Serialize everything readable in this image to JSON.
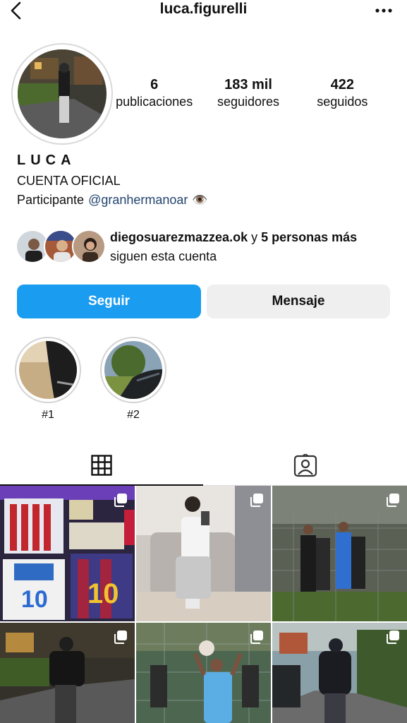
{
  "header": {
    "username": "luca.figurelli",
    "back_icon": "chevron-left-icon",
    "more_icon": "more-horizontal-icon"
  },
  "profile": {
    "stats": [
      {
        "value": "6",
        "label": "publicaciones"
      },
      {
        "value": "183 mil",
        "label": "seguidores"
      },
      {
        "value": "422",
        "label": "seguidos"
      }
    ],
    "name": "LUCA",
    "bio_line1": "CUENTA OFICIAL",
    "bio_prefix": "Participante",
    "bio_mention": "@granhermanoar",
    "bio_emoji": "👁️"
  },
  "mutual": {
    "user": "diegosuarezmazzea.ok",
    "connector": " y ",
    "others": "5 personas más",
    "suffix": " siguen esta cuenta"
  },
  "actions": {
    "follow": "Seguir",
    "message": "Mensaje"
  },
  "highlights": [
    {
      "label": "#1"
    },
    {
      "label": "#2"
    }
  ],
  "tabs": {
    "posts_icon": "grid-icon",
    "tagged_icon": "tagged-person-icon"
  },
  "colors": {
    "follow_button": "#1a9cf0",
    "message_button": "#efefef",
    "mention": "#23446f"
  }
}
